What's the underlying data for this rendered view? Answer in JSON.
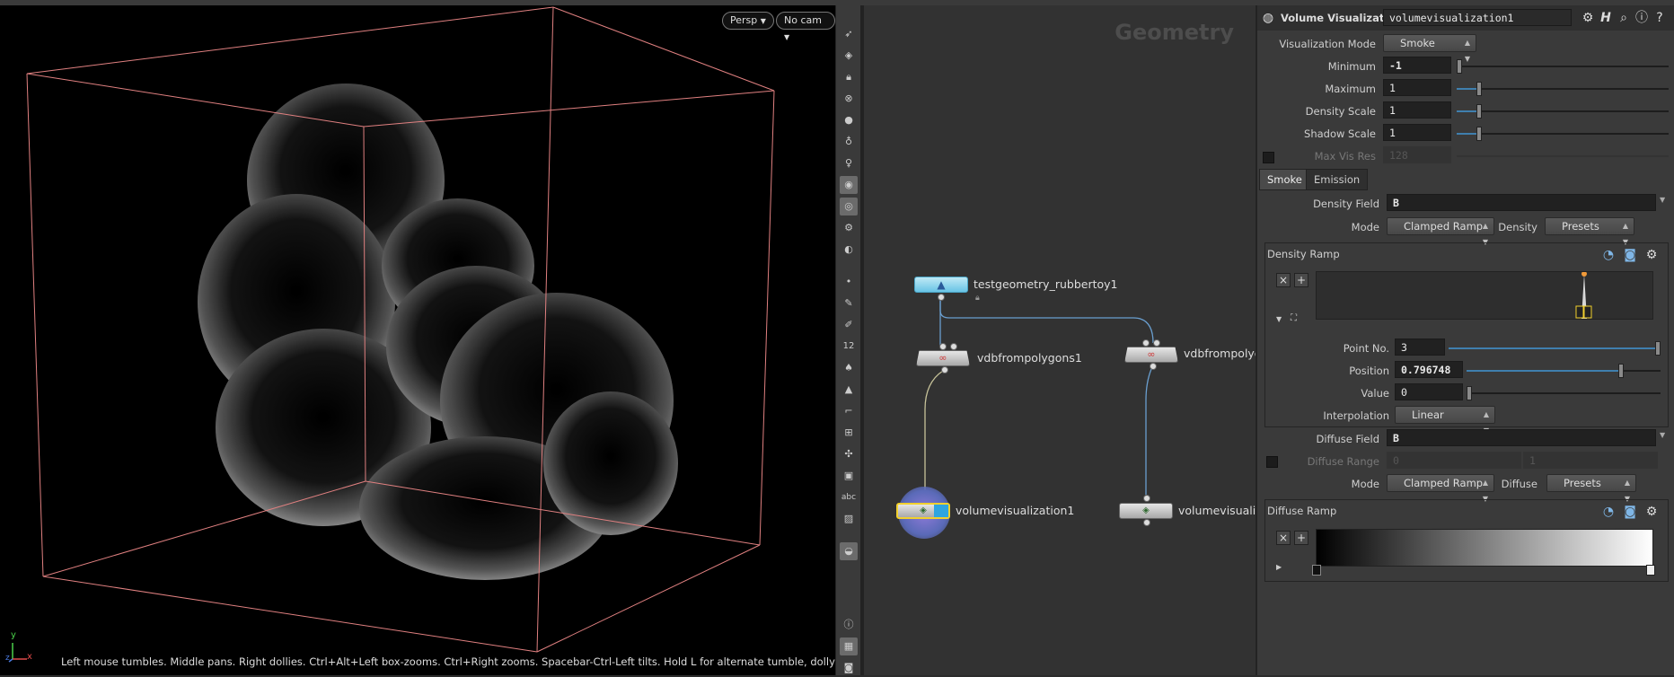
{
  "viewport": {
    "persp_label": "Persp",
    "cam_label": "No cam",
    "help_text": "Left mouse tumbles. Middle pans. Right dollies. Ctrl+Alt+Left box-zooms. Ctrl+Right zooms. Spacebar-Ctrl-Left tilts. Hold L for alternate tumble, dolly, and zoom.",
    "axis_y": "y",
    "axis_x": "x",
    "axis_z": "z"
  },
  "viewport_tools": {
    "labels": {
      "num12": "12",
      "abc": "abc"
    },
    "icons": [
      "select-arrow-icon",
      "transform-icon",
      "lock-icon",
      "wireframe-icon",
      "shading-icon",
      "light-icon",
      "headlight-icon",
      "ghost-icon",
      "camera-icon",
      "display-options-icon",
      "visibility-icon",
      "ortho-icon",
      "point-icon",
      "brush-icon",
      "pen-icon",
      "number-icon",
      "paint-icon",
      "stamp-icon",
      "corner-icon",
      "snap-icon",
      "pivot-icon",
      "layers-icon",
      "text-icon",
      "image-icon",
      "pin-icon",
      "info-icon",
      "grid-icon",
      "snapshot-icon"
    ]
  },
  "network": {
    "title": "Geometry",
    "nodes": {
      "rubbertoy": "testgeometry_rubbertoy1",
      "vdb1": "vdbfrompolygons1",
      "vdb2": "vdbfrompolyg",
      "volvis1": "volumevisualization1",
      "volvis2": "volumevisualiza"
    }
  },
  "params": {
    "node_type": "Volume Visualization",
    "node_name": "volumevisualization1",
    "vis_mode_label": "Visualization Mode",
    "vis_mode_value": "Smoke",
    "rows": {
      "minimum_label": "Minimum",
      "minimum_value": "-1",
      "maximum_label": "Maximum",
      "maximum_value": "1",
      "density_scale_label": "Density Scale",
      "density_scale_value": "1",
      "shadow_scale_label": "Shadow Scale",
      "shadow_scale_value": "1",
      "max_vis_res_label": "Max Vis Res",
      "max_vis_res_value": "128"
    },
    "tabs": {
      "smoke": "Smoke",
      "emission": "Emission"
    },
    "density": {
      "field_label": "Density Field",
      "field_value": "B",
      "mode_label": "Mode",
      "mode_value": "Clamped Ramp",
      "presets_prefix": "Density",
      "presets_value": "Presets",
      "ramp_label": "Density Ramp",
      "ramp_value": 0.796748,
      "point_no_label": "Point No.",
      "point_no_value": "3",
      "position_label": "Position",
      "position_value": "0.796748",
      "value_label": "Value",
      "value_value": "0",
      "interp_label": "Interpolation",
      "interp_value": "Linear"
    },
    "diffuse": {
      "field_label": "Diffuse Field",
      "field_value": "B",
      "range_label": "Diffuse Range",
      "range_min": "0",
      "range_max": "1",
      "mode_label": "Mode",
      "mode_value": "Clamped Ramp",
      "presets_prefix": "Diffuse",
      "presets_value": "Presets",
      "ramp_label": "Diffuse Ramp"
    },
    "buttons": {
      "remove": "×",
      "add": "+"
    }
  },
  "colors": {
    "bbox": "#e08080",
    "selection": "#f2d02d",
    "slider_fill": "#3f7fae",
    "wire_blue": "#6a9fd0",
    "wire_yellow": "#c8c49a"
  }
}
